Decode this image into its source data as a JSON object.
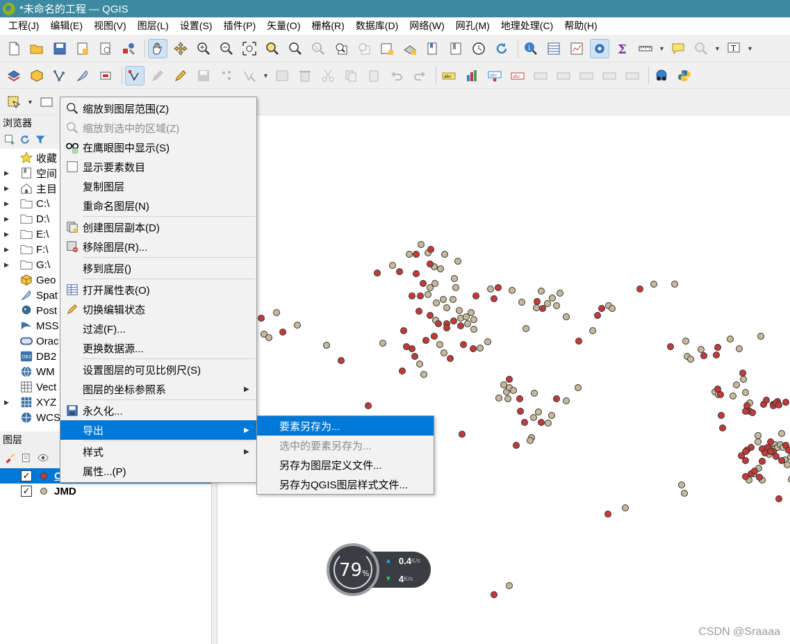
{
  "window": {
    "title": "*未命名的工程 — QGIS"
  },
  "menubar": [
    "工程(J)",
    "编辑(E)",
    "视图(V)",
    "图层(L)",
    "设置(S)",
    "插件(P)",
    "矢量(O)",
    "栅格(R)",
    "数据库(D)",
    "网络(W)",
    "网孔(M)",
    "地理处理(C)",
    "帮助(H)"
  ],
  "browser": {
    "header": "浏览器",
    "items": [
      {
        "label": "收藏",
        "icon": "star-icon",
        "expandable": false
      },
      {
        "label": "空间",
        "icon": "bookmark-icon",
        "expandable": true
      },
      {
        "label": "主目",
        "icon": "home-icon",
        "expandable": true
      },
      {
        "label": "C:\\",
        "icon": "folder-icon",
        "expandable": true
      },
      {
        "label": "D:\\",
        "icon": "folder-icon",
        "expandable": true
      },
      {
        "label": "E:\\",
        "icon": "folder-icon",
        "expandable": true
      },
      {
        "label": "F:\\",
        "icon": "folder-icon",
        "expandable": true
      },
      {
        "label": "G:\\",
        "icon": "folder-icon",
        "expandable": true
      },
      {
        "label": "Geo",
        "icon": "geopackage-icon",
        "expandable": false
      },
      {
        "label": "Spat",
        "icon": "spatialite-icon",
        "expandable": false
      },
      {
        "label": "Post",
        "icon": "postgis-icon",
        "expandable": false
      },
      {
        "label": "MSS",
        "icon": "mssql-icon",
        "expandable": false
      },
      {
        "label": "Orac",
        "icon": "oracle-icon",
        "expandable": false
      },
      {
        "label": "DB2",
        "icon": "db2-icon",
        "expandable": false
      },
      {
        "label": "WM",
        "icon": "wms-icon",
        "expandable": false
      },
      {
        "label": "Vect",
        "icon": "vector-tiles-icon",
        "expandable": false
      },
      {
        "label": "XYZ",
        "icon": "xyz-tiles-icon",
        "expandable": true
      },
      {
        "label": "WCS",
        "icon": "wcs-icon",
        "expandable": false
      }
    ]
  },
  "layers": {
    "header": "图层",
    "items": [
      {
        "label": "Output layer",
        "checked": "✓",
        "dot_color": "#c43a3a",
        "selected": true
      },
      {
        "label": "JMD",
        "checked": "✓",
        "dot_color": "#c8b99b",
        "selected": false
      }
    ]
  },
  "context_menu": {
    "items": [
      {
        "label": "缩放到图层范围(Z)",
        "icon": "zoom-layer-icon",
        "disabled": false
      },
      {
        "label": "缩放到选中的区域(Z)",
        "icon": "zoom-selection-icon",
        "disabled": true
      },
      {
        "label": "在鹰眼图中显示(S)",
        "icon": "overview-icon",
        "disabled": false
      },
      {
        "label": "显示要素数目",
        "icon": "checkbox-icon",
        "disabled": false
      },
      {
        "label": "复制图层",
        "icon": "",
        "disabled": false
      },
      {
        "label": "重命名图层(N)",
        "icon": "",
        "disabled": false,
        "sep_after": true
      },
      {
        "label": "创建图层副本(D)",
        "icon": "duplicate-layer-icon",
        "disabled": false
      },
      {
        "label": "移除图层(R)...",
        "icon": "remove-layer-icon",
        "disabled": false,
        "sep_after": true
      },
      {
        "label": "移到底层()",
        "icon": "",
        "disabled": false,
        "sep_after": true
      },
      {
        "label": "打开属性表(O)",
        "icon": "attribute-table-icon",
        "disabled": false
      },
      {
        "label": "切换编辑状态",
        "icon": "pencil-icon",
        "disabled": false
      },
      {
        "label": "过滤(F)...",
        "icon": "",
        "disabled": false
      },
      {
        "label": "更换数据源...",
        "icon": "",
        "disabled": false,
        "sep_after": true
      },
      {
        "label": "设置图层的可见比例尺(S)",
        "icon": "",
        "disabled": false
      },
      {
        "label": "图层的坐标参照系",
        "icon": "",
        "disabled": false,
        "submenu": true,
        "sep_after": true
      },
      {
        "label": "永久化...",
        "icon": "save-icon",
        "disabled": false
      },
      {
        "label": "导出",
        "icon": "",
        "disabled": false,
        "submenu": true,
        "highlighted": true,
        "sep_after": true
      },
      {
        "label": "样式",
        "icon": "",
        "disabled": false,
        "submenu": true
      },
      {
        "label": "属性...(P)",
        "icon": "",
        "disabled": false
      }
    ]
  },
  "export_submenu": {
    "items": [
      {
        "label": "要素另存为...",
        "highlighted": true,
        "disabled": false
      },
      {
        "label": "选中的要素另存为...",
        "highlighted": false,
        "disabled": true
      },
      {
        "label": "另存为图层定义文件...",
        "highlighted": false,
        "disabled": false
      },
      {
        "label": "另存为QGIS图层样式文件...",
        "highlighted": false,
        "disabled": false
      }
    ]
  },
  "speed_widget": {
    "percent": "79",
    "percent_symbol": "%",
    "upload": "0.4",
    "download": "4",
    "unit": "K/s"
  },
  "watermark": "CSDN @Sraaaa",
  "colors": {
    "title_bar": "#3c89a0",
    "selection": "#0078d7",
    "red_points": "#c43a3a",
    "tan_points": "#c8b99b"
  }
}
